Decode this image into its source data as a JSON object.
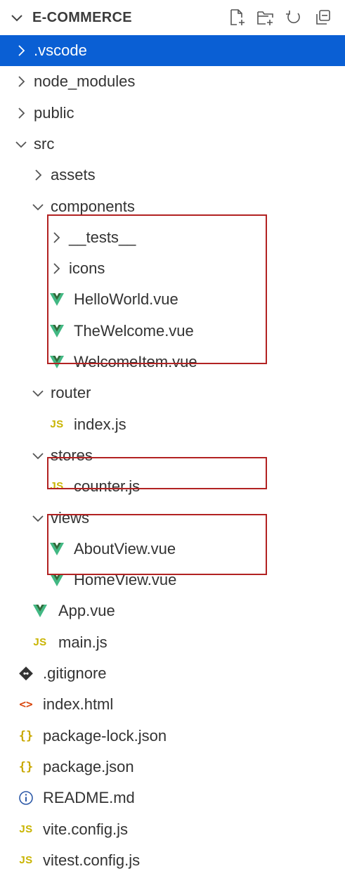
{
  "explorer": {
    "title": "E-COMMERCE",
    "toolbar": [
      {
        "name": "new-file-icon"
      },
      {
        "name": "new-folder-icon"
      },
      {
        "name": "refresh-icon"
      },
      {
        "name": "collapse-all-icon"
      }
    ]
  },
  "tree": [
    {
      "label": ".vscode",
      "depth": 0,
      "kind": "folder",
      "open": false,
      "selected": true
    },
    {
      "label": "node_modules",
      "depth": 0,
      "kind": "folder",
      "open": false
    },
    {
      "label": "public",
      "depth": 0,
      "kind": "folder",
      "open": false
    },
    {
      "label": "src",
      "depth": 0,
      "kind": "folder",
      "open": true
    },
    {
      "label": "assets",
      "depth": 1,
      "kind": "folder",
      "open": false
    },
    {
      "label": "components",
      "depth": 1,
      "kind": "folder",
      "open": true
    },
    {
      "label": "__tests__",
      "depth": 2,
      "kind": "folder",
      "open": false
    },
    {
      "label": "icons",
      "depth": 2,
      "kind": "folder",
      "open": false
    },
    {
      "label": "HelloWorld.vue",
      "depth": 2,
      "kind": "vue"
    },
    {
      "label": "TheWelcome.vue",
      "depth": 2,
      "kind": "vue"
    },
    {
      "label": "WelcomeItem.vue",
      "depth": 2,
      "kind": "vue"
    },
    {
      "label": "router",
      "depth": 1,
      "kind": "folder",
      "open": true
    },
    {
      "label": "index.js",
      "depth": 2,
      "kind": "js"
    },
    {
      "label": "stores",
      "depth": 1,
      "kind": "folder",
      "open": true
    },
    {
      "label": "counter.js",
      "depth": 2,
      "kind": "js"
    },
    {
      "label": "views",
      "depth": 1,
      "kind": "folder",
      "open": true
    },
    {
      "label": "AboutView.vue",
      "depth": 2,
      "kind": "vue"
    },
    {
      "label": "HomeView.vue",
      "depth": 2,
      "kind": "vue"
    },
    {
      "label": "App.vue",
      "depth": 1,
      "kind": "vue"
    },
    {
      "label": "main.js",
      "depth": 1,
      "kind": "js"
    },
    {
      "label": ".gitignore",
      "depth": 0,
      "kind": "git"
    },
    {
      "label": "index.html",
      "depth": 0,
      "kind": "html"
    },
    {
      "label": "package-lock.json",
      "depth": 0,
      "kind": "json"
    },
    {
      "label": "package.json",
      "depth": 0,
      "kind": "json"
    },
    {
      "label": "README.md",
      "depth": 0,
      "kind": "info"
    },
    {
      "label": "vite.config.js",
      "depth": 0,
      "kind": "js"
    },
    {
      "label": "vitest.config.js",
      "depth": 0,
      "kind": "js"
    }
  ],
  "icon_glyphs": {
    "js": "JS",
    "html": "<>",
    "json": "{}"
  },
  "colors": {
    "selection": "#0a5fd4",
    "highlight_box": "#b22222",
    "vue_green": "#41b883",
    "js_yellow": "#c9b400"
  }
}
